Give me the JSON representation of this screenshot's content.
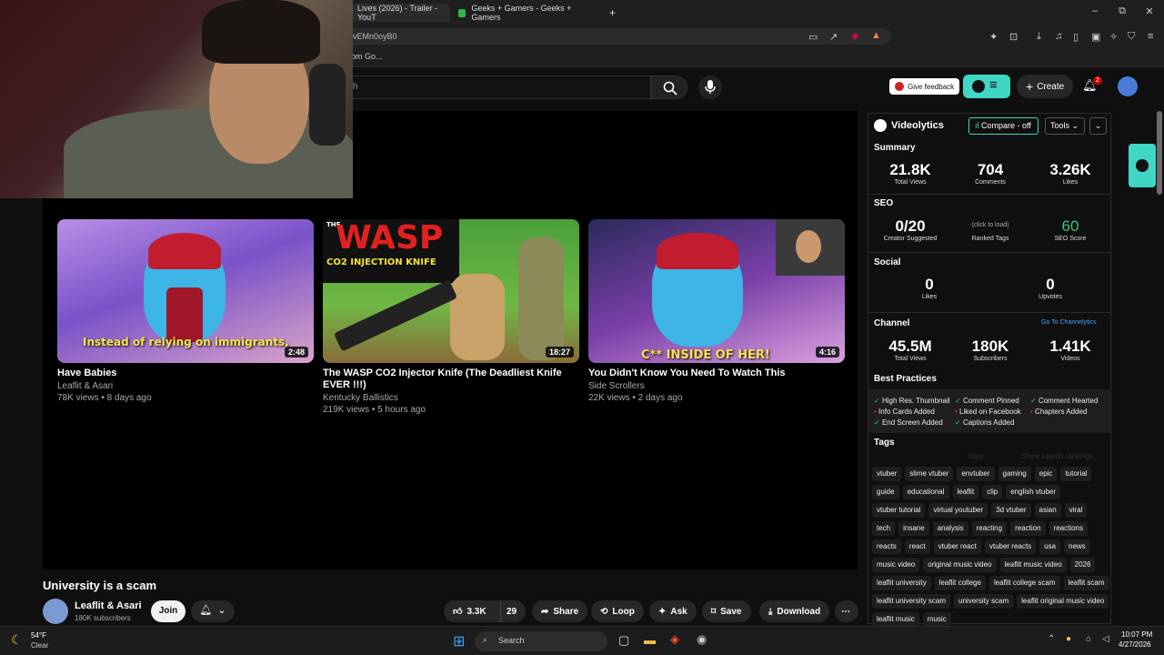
{
  "browser": {
    "tabs": [
      {
        "label": "Lives (2026) - Trailer - YouT"
      },
      {
        "label": "Geeks + Gamers - Geeks + Gamers"
      }
    ],
    "new_tab": "+",
    "window_controls": {
      "minimize": "–",
      "maximize": "⧉",
      "close": "✕"
    },
    "url": "vEMn0oyB0",
    "bookmark": "om Go..."
  },
  "youtube_header": {
    "search_placeholder": "ch",
    "feedback_label": "Give feedback",
    "create_label": "Create",
    "notification_count": "2"
  },
  "end_screen": [
    {
      "title": "Have Babies",
      "channel": "Leaflit & Asari",
      "meta": "78K views • 8 days ago",
      "duration": "2:48",
      "overlay_text": "Instead of relying on immigrants,"
    },
    {
      "title": "The WASP CO2 Injector Knife (The Deadliest Knife EVER !!!)",
      "channel": "Kentucky Ballistics",
      "meta": "219K views • 5 hours ago",
      "duration": "18:27",
      "overlay_text": "WASP",
      "overlay_sub": "CO2 INJECTION KNIFE",
      "overlay_the": "THE"
    },
    {
      "title": "You Didn't Know You Need To Watch This",
      "channel": "Side Scrollers",
      "meta": "22K views • 2 days ago",
      "duration": "4:16",
      "overlay_text": "C** INSIDE OF HER!"
    }
  ],
  "video": {
    "title": "University is a scam",
    "channel": "Leaflit & Asari",
    "subscribers": "180K subscribers",
    "join_label": "Join",
    "likes": "3.3K",
    "comments": "29",
    "share_label": "Share",
    "loop_label": "Loop",
    "ask_label": "Ask",
    "save_label": "Save",
    "download_label": "Download",
    "more_label": "⋯"
  },
  "videolytics": {
    "brand": "Videolytics",
    "compare_label": "Compare - off",
    "tools_label": "Tools",
    "summary_heading": "Summary",
    "summary": [
      {
        "value": "21.8K",
        "label": "Total Views"
      },
      {
        "value": "704",
        "label": "Comments"
      },
      {
        "value": "3.26K",
        "label": "Likes"
      }
    ],
    "seo_heading": "SEO",
    "seo": {
      "creator_value": "0/20",
      "creator_label": "Creator Suggested",
      "ranked_hint": "(click to load)",
      "ranked_label": "Ranked Tags",
      "score_value": "60",
      "score_label": "SEO Score"
    },
    "social_heading": "Social",
    "social": [
      {
        "value": "0",
        "label": "Likes"
      },
      {
        "value": "0",
        "label": "Upvotes"
      }
    ],
    "channel_heading": "Channel",
    "channel_link": "Go To Channelytics",
    "channel": [
      {
        "value": "45.5M",
        "label": "Total Views"
      },
      {
        "value": "180K",
        "label": "Subscribers"
      },
      {
        "value": "1.41K",
        "label": "Videos"
      }
    ],
    "best_practices_heading": "Best Practices",
    "best_practices": [
      "High Res. Thumbnail",
      "Comment Pinned",
      "Comment Hearted",
      "Info Cards Added",
      "Liked on Facebook",
      "Chapters Added",
      "End Screen Added",
      "Captions Added"
    ],
    "tags_heading": "Tags",
    "copy_label": "copy",
    "rankings_label": "Show search rankings",
    "tags": [
      "vtuber",
      "slime vtuber",
      "envtuber",
      "gaming",
      "epic",
      "tutorial",
      "guide",
      "educational",
      "leaflit",
      "clip",
      "english vtuber",
      "vtuber tutorial",
      "virtual youtuber",
      "3d vtuber",
      "asian",
      "viral",
      "tech",
      "insane",
      "analysis",
      "reacting",
      "reaction",
      "reactions",
      "reacts",
      "react",
      "vtuber react",
      "vtuber reacts",
      "usa",
      "news",
      "music video",
      "original music video",
      "leaflit music video",
      "2026",
      "leaflit university",
      "leaflit college",
      "leaflit college scam",
      "leaflit scam",
      "leaflit university scam",
      "university scam",
      "leaflit original music video",
      "leaflit music",
      "music"
    ]
  },
  "taskbar": {
    "weather_temp": "54°F",
    "weather_cond": "Clear",
    "search_label": "Search",
    "time": "10:07 PM",
    "date": "4/27/2026"
  },
  "colors": {
    "accent": "#3fd6c4",
    "yt_red": "#cc0000",
    "seo_green": "#35c47a",
    "link_blue": "#3ea6ff"
  }
}
